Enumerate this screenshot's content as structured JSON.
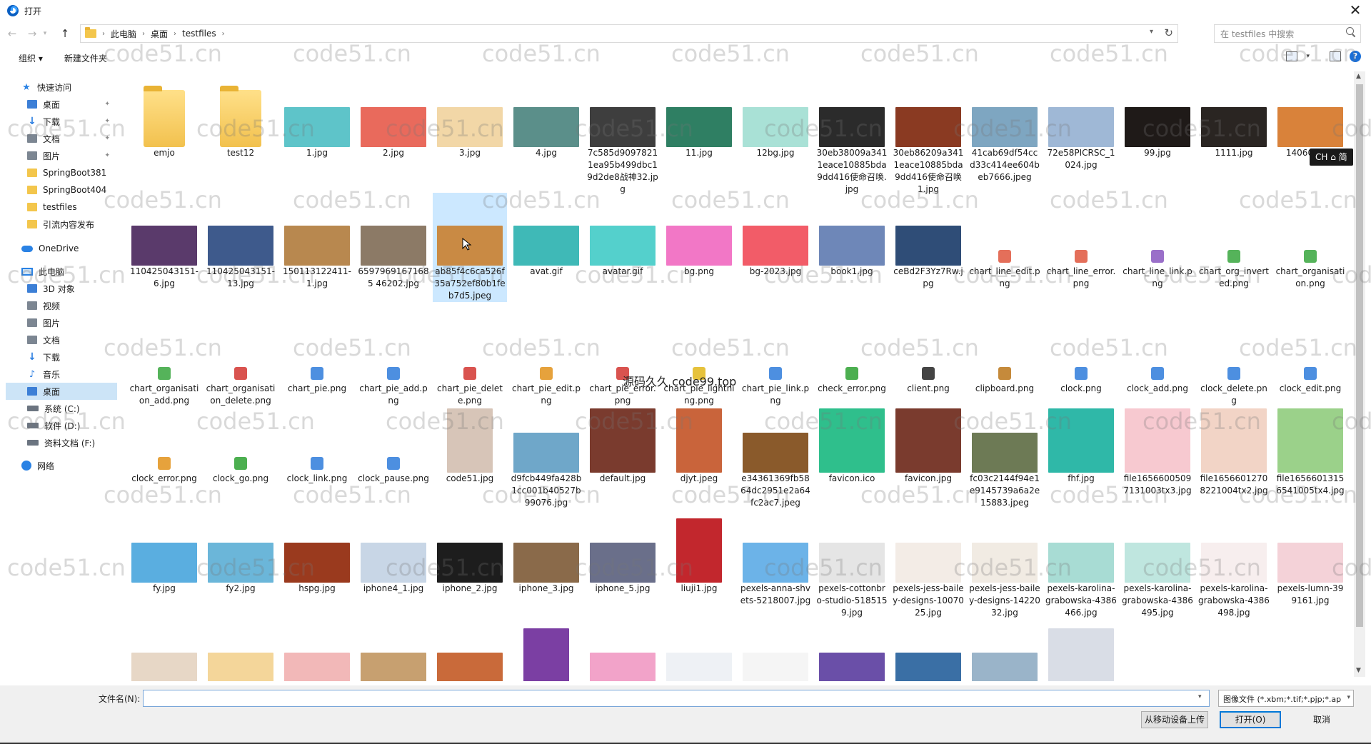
{
  "window": {
    "title": "打开"
  },
  "address": {
    "crumbs": [
      "此电脑",
      "桌面",
      "testfiles"
    ],
    "search_placeholder": "在 testfiles 中搜索"
  },
  "toolbar": {
    "organize": "组织 ▾",
    "new_folder": "新建文件夹"
  },
  "sidebar": {
    "items": [
      {
        "label": "快速访问",
        "icon": "star-icon"
      },
      {
        "label": "桌面",
        "icon": "desktop-icon"
      },
      {
        "label": "下载",
        "icon": "download-icon"
      },
      {
        "label": "文档",
        "icon": "document-icon"
      },
      {
        "label": "图片",
        "icon": "picture-icon"
      },
      {
        "label": "SpringBoot381",
        "icon": "folder-icon"
      },
      {
        "label": "SpringBoot404",
        "icon": "folder-icon"
      },
      {
        "label": "testfiles",
        "icon": "folder-icon"
      },
      {
        "label": "引流内容发布",
        "icon": "folder-icon"
      },
      {
        "label": "OneDrive",
        "icon": "cloud-icon"
      },
      {
        "label": "此电脑",
        "icon": "pc-icon"
      },
      {
        "label": "3D 对象",
        "icon": "cube-icon"
      },
      {
        "label": "视频",
        "icon": "video-icon"
      },
      {
        "label": "图片",
        "icon": "picture-icon"
      },
      {
        "label": "文档",
        "icon": "document-icon"
      },
      {
        "label": "下载",
        "icon": "download-icon"
      },
      {
        "label": "音乐",
        "icon": "music-icon"
      },
      {
        "label": "桌面",
        "icon": "desktop-icon"
      },
      {
        "label": "系统 (C:)",
        "icon": "drive-icon"
      },
      {
        "label": "软件 (D:)",
        "icon": "drive-icon"
      },
      {
        "label": "资料文档 (F:)",
        "icon": "drive-icon"
      },
      {
        "label": "网络",
        "icon": "network-icon"
      }
    ]
  },
  "files": [
    {
      "name": "emjo",
      "kind": "folder"
    },
    {
      "name": "test12",
      "kind": "folder"
    },
    {
      "name": "1.jpg",
      "kind": "img",
      "color": "#5ec4c9"
    },
    {
      "name": "2.jpg",
      "kind": "img",
      "color": "#e96a5c"
    },
    {
      "name": "3.jpg",
      "kind": "img",
      "color": "#f2d7a7"
    },
    {
      "name": "4.jpg",
      "kind": "img",
      "color": "#5b8f8a"
    },
    {
      "name": "7c585d90978211ea95b499dbc19d2de8战神32.jpg",
      "kind": "img",
      "color": "#3e3e3e"
    },
    {
      "name": "11.jpg",
      "kind": "img",
      "color": "#2f7f63"
    },
    {
      "name": "12bg.jpg",
      "kind": "img",
      "color": "#a9e1d6"
    },
    {
      "name": "30eb38009a3411eace10885bda9dd416使命召唤.jpg",
      "kind": "img",
      "color": "#2b2b2b"
    },
    {
      "name": "30eb86209a3411eace10885bda9dd416使命召唤1.jpg",
      "kind": "img",
      "color": "#8a3a22"
    },
    {
      "name": "41cab69df54ccd33c414ee604beb7666.jpeg",
      "kind": "img",
      "color": "#7ea6c1"
    },
    {
      "name": "72e58PICRSC_1024.jpg",
      "kind": "img",
      "color": "#9fb8d6"
    },
    {
      "name": "99.jpg",
      "kind": "img",
      "color": "#1f1a18"
    },
    {
      "name": "1111.jpg",
      "kind": "img",
      "color": "#2a2522"
    },
    {
      "name": "14060...jpg",
      "kind": "img",
      "color": "#d9823a"
    },
    {
      "name": "110425043151-6.jpg",
      "kind": "img",
      "color": "#5a3a6b"
    },
    {
      "name": "110425043151-13.jpg",
      "kind": "img",
      "color": "#3e5a8c"
    },
    {
      "name": "150113122411-1.jpg",
      "kind": "img",
      "color": "#b8884f"
    },
    {
      "name": "65979691671685 46202.jpg",
      "kind": "img",
      "color": "#8c7a66"
    },
    {
      "name": "ab85f4c6ca526f35a752ef80b1feb7d5.jpeg",
      "kind": "img",
      "color": "#c98a44"
    },
    {
      "name": "avat.gif",
      "kind": "img",
      "color": "#3fb9b7"
    },
    {
      "name": "avatar.gif",
      "kind": "img",
      "color": "#54d0cc"
    },
    {
      "name": "bg.png",
      "kind": "img",
      "color": "#f277c6"
    },
    {
      "name": "bg-2023.jpg",
      "kind": "img",
      "color": "#f25c68"
    },
    {
      "name": "book1.jpg",
      "kind": "img",
      "color": "#6e87b8"
    },
    {
      "name": "ceBd2F3Yz7Rw.jpg",
      "kind": "img",
      "color": "#2f4d77"
    },
    {
      "name": "chart_line_edit.png",
      "kind": "icon",
      "color": "#e46f5a"
    },
    {
      "name": "chart_line_error.png",
      "kind": "icon",
      "color": "#e46f5a"
    },
    {
      "name": "chart_line_link.png",
      "kind": "icon",
      "color": "#9a6fc9"
    },
    {
      "name": "chart_org_inverted.png",
      "kind": "icon",
      "color": "#55b35a"
    },
    {
      "name": "chart_organisation.png",
      "kind": "icon",
      "color": "#55b35a"
    },
    {
      "name": "chart_organisation_add.png",
      "kind": "icon",
      "color": "#55b35a"
    },
    {
      "name": "chart_organisation_delete.png",
      "kind": "icon",
      "color": "#d9534f"
    },
    {
      "name": "chart_pie.png",
      "kind": "icon",
      "color": "#4d8fe0"
    },
    {
      "name": "chart_pie_add.png",
      "kind": "icon",
      "color": "#4d8fe0"
    },
    {
      "name": "chart_pie_delete.png",
      "kind": "icon",
      "color": "#d9534f"
    },
    {
      "name": "chart_pie_edit.png",
      "kind": "icon",
      "color": "#e6a23c"
    },
    {
      "name": "chart_pie_error.png",
      "kind": "icon",
      "color": "#d9534f"
    },
    {
      "name": "chart_pie_lightning.png",
      "kind": "icon",
      "color": "#e6c23c"
    },
    {
      "name": "chart_pie_link.png",
      "kind": "icon",
      "color": "#4d8fe0"
    },
    {
      "name": "check_error.png",
      "kind": "icon",
      "color": "#4caf50"
    },
    {
      "name": "client.png",
      "kind": "icon",
      "color": "#444444"
    },
    {
      "name": "clipboard.png",
      "kind": "icon",
      "color": "#c58a3b"
    },
    {
      "name": "clock.png",
      "kind": "icon",
      "color": "#4d8fe0"
    },
    {
      "name": "clock_add.png",
      "kind": "icon",
      "color": "#4d8fe0"
    },
    {
      "name": "clock_delete.png",
      "kind": "icon",
      "color": "#4d8fe0"
    },
    {
      "name": "clock_edit.png",
      "kind": "icon",
      "color": "#4d8fe0"
    },
    {
      "name": "clock_error.png",
      "kind": "icon",
      "color": "#e6a23c"
    },
    {
      "name": "clock_go.png",
      "kind": "icon",
      "color": "#4caf50"
    },
    {
      "name": "clock_link.png",
      "kind": "icon",
      "color": "#4d8fe0"
    },
    {
      "name": "clock_pause.png",
      "kind": "icon",
      "color": "#4d8fe0"
    },
    {
      "name": "code51.jpg",
      "kind": "tall",
      "color": "#d7c5b8"
    },
    {
      "name": "d9fcb449fa428b1cc001b40527b99076.jpg",
      "kind": "img",
      "color": "#6fa7c9"
    },
    {
      "name": "default.jpg",
      "kind": "sq",
      "color": "#7a3b2e"
    },
    {
      "name": "djyt.jpeg",
      "kind": "tall",
      "color": "#c9643b"
    },
    {
      "name": "e34361369fb5864dc2951e2a64fc2ac7.jpeg",
      "kind": "img",
      "color": "#8a5a2b"
    },
    {
      "name": "favicon.ico",
      "kind": "sq",
      "color": "#2fbf8c"
    },
    {
      "name": "favicon.jpg",
      "kind": "sq",
      "color": "#7a3b2e"
    },
    {
      "name": "fc03c2144f94e1e9145739a6a2e15883.jpeg",
      "kind": "img",
      "color": "#6d7a55"
    },
    {
      "name": "fhf.jpg",
      "kind": "sq",
      "color": "#2fb8a8"
    },
    {
      "name": "file16566005097131003tx3.jpg",
      "kind": "sq",
      "color": "#f7c9d0"
    },
    {
      "name": "file16566012708221004tx2.jpg",
      "kind": "sq",
      "color": "#f2d4c6"
    },
    {
      "name": "file16566013156541005tx4.jpg",
      "kind": "sq",
      "color": "#9bd18a"
    },
    {
      "name": "fy.jpg",
      "kind": "img",
      "color": "#5aaee0"
    },
    {
      "name": "fy2.jpg",
      "kind": "img",
      "color": "#6bb6d9"
    },
    {
      "name": "hspg.jpg",
      "kind": "img",
      "color": "#9a3a1e"
    },
    {
      "name": "iphone4_1.jpg",
      "kind": "img",
      "color": "#c8d6e6"
    },
    {
      "name": "iphone_2.jpg",
      "kind": "img",
      "color": "#1d1d1d"
    },
    {
      "name": "iphone_3.jpg",
      "kind": "img",
      "color": "#8a6a4a"
    },
    {
      "name": "iphone_5.jpg",
      "kind": "img",
      "color": "#6a6f8a"
    },
    {
      "name": "liuji1.jpg",
      "kind": "tall",
      "color": "#c2272d"
    },
    {
      "name": "pexels-anna-shvets-5218007.jpg",
      "kind": "img",
      "color": "#6cb3e8"
    },
    {
      "name": "pexels-cottonbro-studio-5185159.jpg",
      "kind": "img",
      "color": "#e5e5e5"
    },
    {
      "name": "pexels-jess-bailey-designs-1007025.jpg",
      "kind": "img",
      "color": "#f3ece6"
    },
    {
      "name": "pexels-jess-bailey-designs-1422032.jpg",
      "kind": "img",
      "color": "#f1ebe3"
    },
    {
      "name": "pexels-karolina-grabowska-4386466.jpg",
      "kind": "img",
      "color": "#a8dcd4"
    },
    {
      "name": "pexels-karolina-grabowska-4386495.jpg",
      "kind": "img",
      "color": "#bfe6df"
    },
    {
      "name": "pexels-karolina-grabowska-4386498.jpg",
      "kind": "img",
      "color": "#f7eeee"
    },
    {
      "name": "pexels-lumn-399161.jpg",
      "kind": "img",
      "color": "#f4d2d8"
    },
    {
      "name": "",
      "kind": "img",
      "color": "#e7d7c6"
    },
    {
      "name": "",
      "kind": "img",
      "color": "#f4d69a"
    },
    {
      "name": "",
      "kind": "img",
      "color": "#f2b8b8"
    },
    {
      "name": "",
      "kind": "img",
      "color": "#c7a070"
    },
    {
      "name": "",
      "kind": "img",
      "color": "#c96a3a"
    },
    {
      "name": "",
      "kind": "tall",
      "color": "#7b3fa3"
    },
    {
      "name": "",
      "kind": "img",
      "color": "#f2a3c9"
    },
    {
      "name": "",
      "kind": "img",
      "color": "#eef1f5"
    },
    {
      "name": "",
      "kind": "img",
      "color": "#f5f5f5"
    },
    {
      "name": "",
      "kind": "img",
      "color": "#6a4fa8"
    },
    {
      "name": "",
      "kind": "img",
      "color": "#3a6fa5"
    },
    {
      "name": "",
      "kind": "img",
      "color": "#9ab4c9"
    },
    {
      "name": "",
      "kind": "sq",
      "color": "#d9dde6"
    }
  ],
  "bottom": {
    "filename_label": "文件名(N):",
    "filename_value": "",
    "filetype": "图像文件 (*.xbm;*.tif;*.pjp;*.ap",
    "upload_button": "从移动设备上传",
    "open_button": "打开(O)",
    "cancel_button": "取消"
  },
  "overlay": {
    "text": "源码久久 code99.top",
    "ime": "CH ⌂ 简",
    "watermark": "code51.cn"
  }
}
